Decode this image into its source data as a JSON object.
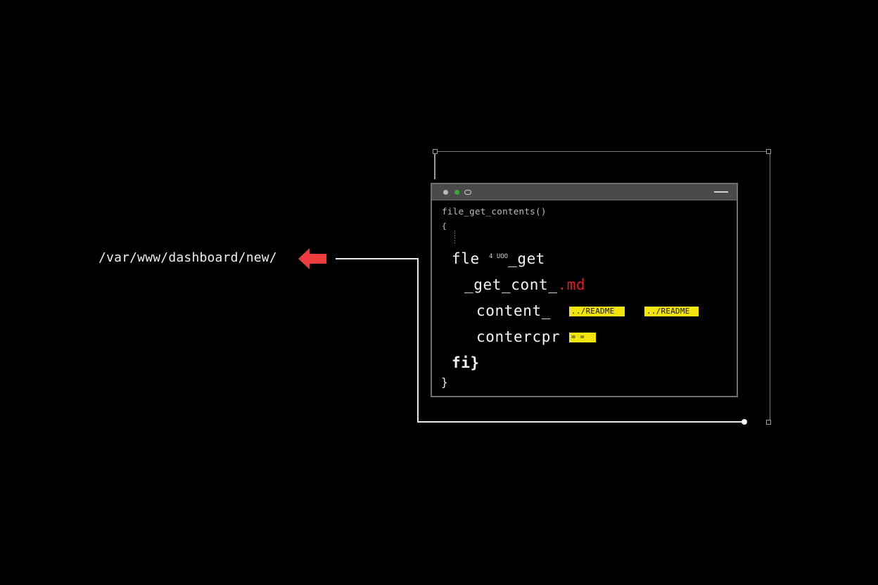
{
  "path_label": "/var/www/dashboard/new/",
  "accent_colors": {
    "arrow": "#ef3b3b",
    "highlight": "#f2e40f",
    "extension": "#e0191b",
    "titlebar_dot_green": "#3ea63e"
  },
  "icons": {
    "arrow": "arrow-left-icon",
    "window_dot_1": "circle-icon",
    "window_dot_2": "circle-icon",
    "window_dot_3": "toggle-icon",
    "minimize": "minimize-icon"
  },
  "terminal": {
    "header_line": "file_get_contents()",
    "open_brace": "{",
    "dots": ":\n:\n:",
    "line1_a": "fle",
    "line1_tiny": "4 UOO",
    "line1_b": "_get",
    "line2_a": "_get_cont_",
    "line2_ext": ".md",
    "line3": "content_",
    "line3_tag1": "../README",
    "line3_tag2": "../README",
    "line4": "contercpr",
    "line4_tag": "= =",
    "line5": "fi}",
    "close_brace": "}"
  }
}
